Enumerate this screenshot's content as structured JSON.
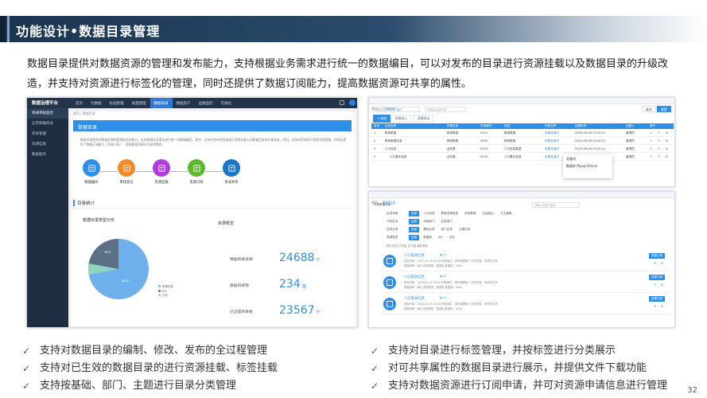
{
  "slide": {
    "title": "功能设计•数据目录管理",
    "intro": "数据目录提供对数据资源的管理和发布能力，支持根据业务需求进行统一的数据编目，可以对发布的目录进行资源挂载以及数据目录的升级改造，并支持对资源进行标签化的管理，同时还提供了数据订阅能力，提高数据资源可共享的属性。",
    "page_number": "32",
    "bullets_left": [
      "支持对数据目录的编制、修改、发布的全过程管理",
      "支持对已生效的数据目录的进行资源挂载、标签挂载",
      "支持按基础、部门、主题进行目录分类管理"
    ],
    "bullets_right": [
      "支持对目录进行标签管理，并按标签进行分类展示",
      "对可共享属性的数据目录进行展示，并提供文件下载功能",
      "支持对数据资源进行订阅申请，并可对资源申请信息进行管理"
    ],
    "check_glyph": "✓"
  },
  "left_app": {
    "logo": "数据治理平台",
    "nav": [
      "首页",
      "元数据",
      "标准管理",
      "质量管理",
      "数据目录",
      "数据资产",
      "运维监控",
      "可视化"
    ],
    "active_nav": 4,
    "sidebar": [
      "目录审核监控",
      "应用库编目录",
      "目录管理",
      "资源挂载",
      "数据服务"
    ],
    "breadcrumb": "首页 / 数据目录",
    "banner_title": "数据目录",
    "banner_desc": "数据目录提供对数据资源的管理和发布能力，支持根据业务需求进行统一的数据编目，其中，支持对发布的目录进行资源挂载以及数据目录的升级改造，同时，支持对资源进行标签化的管理，同时还提供了数据订阅能力（资源订阅）、提高数据资源可共享的属性。",
    "flow": [
      {
        "label": "数据编目",
        "color": "#2d8fe8"
      },
      {
        "label": "审核登记",
        "color": "#f28a2a"
      },
      {
        "label": "资源挂载",
        "color": "#b23be0"
      },
      {
        "label": "资源订阅",
        "color": "#5cb82f"
      },
      {
        "label": "目录共享",
        "color": "#1877c8"
      }
    ],
    "stats_heading": "目录统计",
    "pie_title": "数据目录类型分布",
    "overview_title": "目录概览",
    "stats": [
      {
        "label": "数据目录总数",
        "value": "24688",
        "unit": "个"
      },
      {
        "label": "数据目录数",
        "value": "234",
        "unit": "条"
      },
      {
        "label": "已治理目录数",
        "value": "23567",
        "unit": "个"
      }
    ],
    "pie_labels": {
      "large": "6823",
      "small": "3871"
    },
    "legend": [
      "资源目录",
      "API",
      "文件"
    ]
  },
  "right_top": {
    "tabs": [
      "首页",
      "目录管理"
    ],
    "search_placeholder": "请输入目录名称/编码",
    "search2_placeholder": "请选择目录分类",
    "btn_query": "查询",
    "btn_reset": "重置",
    "tools": [
      "+ 新增",
      "资源导入",
      "资源导出"
    ],
    "headers": [
      "序号",
      "目录名称",
      "所属目录",
      "目录编号",
      "描述",
      "标签名称",
      "创建时间",
      "创建人",
      "操作"
    ],
    "rows": [
      [
        "1",
        "教育数据",
        "教育数据",
        "0001",
        "教育数据",
        "查看关键字",
        "2020-06-08 10:20:51",
        "管理员"
      ],
      [
        "2",
        "教育数据目录",
        "教育数据",
        "0002",
        "教育数据",
        "查看关键字",
        "2020-06-08 10:20:51",
        "管理员"
      ],
      [
        "3",
        "人口信息",
        "全科数",
        "0003",
        "人口信息数据",
        "查看关键字",
        "2020-06-08 10:20:51",
        "管理员"
      ],
      [
        "4",
        "人口基本信息",
        "全科数",
        "0003",
        "人口基本信息",
        "查看关键字",
        "2020-06-08 10:20:51",
        "管理员"
      ]
    ],
    "popup_title": "关键词",
    "popup_items": "数据库 Mysql Oracle"
  },
  "right_bottom": {
    "tabs": [
      "首页",
      "数据目录"
    ],
    "header_label": "共享数据目录",
    "search_placeholder": "请输入关键字搜索",
    "filters": [
      {
        "label": "目录领域",
        "options": [
          "全部",
          "人口信息",
          "教育资源信息",
          "科技教育",
          "社保就业",
          "卫生健康"
        ]
      },
      {
        "label": "行政区划",
        "options": [
          "全部",
          "市级部门",
          "区县部门"
        ]
      },
      {
        "label": "目录分类",
        "options": [
          "全部",
          "基础目录",
          "部门目录",
          "主题目录"
        ]
      },
      {
        "label": "资源类型",
        "options": [
          "全部",
          "数据库",
          "API",
          "文件"
        ]
      }
    ],
    "sort": "默认排序  访问量  访问量  最新更新",
    "cards": [
      {
        "title": "人口基本信息",
        "views": "21",
        "meta": "发布时间：2020-05-18 10:20  所属单位：城市管理部门  共享属性：有条件共享",
        "meta2": "更新频率：每日  资源类型：数据库  数据量：3000",
        "btn": "资源订阅"
      },
      {
        "title": "人口基本信息",
        "views": "21",
        "meta": "发布时间：2020-05-18 10:20  所属单位：城市管理部门  共享属性：有条件共享",
        "meta2": "更新频率：每日  资源类型：数据库  数据量：3000",
        "btn": "资源订阅"
      },
      {
        "title": "人口基本信息",
        "views": "21",
        "meta": "发布时间：2020-05-18 10:20  所属单位：城市管理部门  共享属性：有条件共享",
        "meta2": "更新频率：每日  资源类型：数据库  数据量：3000",
        "btn": "资源订阅"
      }
    ]
  }
}
